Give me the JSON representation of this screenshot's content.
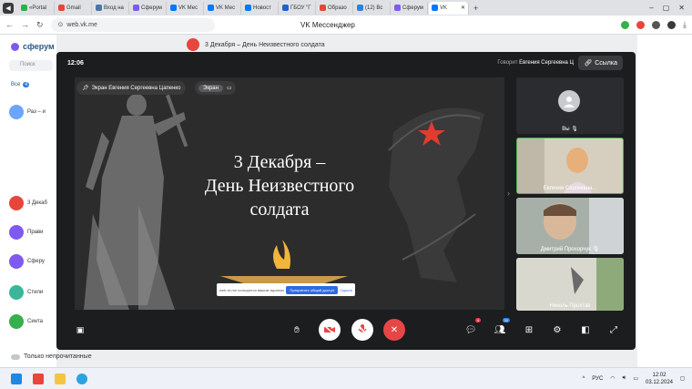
{
  "browser": {
    "tabs": [
      {
        "label": "«Portal",
        "color": "#29b34a"
      },
      {
        "label": "Gmail",
        "color": "#ea4335"
      },
      {
        "label": "Вход на",
        "color": "#4a76a8"
      },
      {
        "label": "Сферум",
        "color": "#7f5af0"
      },
      {
        "label": "VK Мес",
        "color": "#0077ff"
      },
      {
        "label": "VK Мес",
        "color": "#0077ff"
      },
      {
        "label": "Новост",
        "color": "#0077ff"
      },
      {
        "label": "ГБОУ \"Г",
        "color": "#1e63c8"
      },
      {
        "label": "Образо",
        "color": "#e8453c"
      },
      {
        "label": "(12) Вс",
        "color": "#2d81e0"
      },
      {
        "label": "Сферум",
        "color": "#7f5af0"
      }
    ],
    "active_tab": {
      "label": "VK",
      "color": "#0077ff"
    },
    "url": "web.vk.me",
    "page_title": "VK Мессенджер"
  },
  "app": {
    "logo": "сферум",
    "search_placeholder": "Поиск",
    "tabs_all": "Все",
    "tabs_all_count": "4",
    "chat_header_title": "3 Декабря – День Неизвестного солдата",
    "left_chats": [
      {
        "name": "Раз – и",
        "color": "#6aa6ff"
      },
      {
        "name": "3 Декаб",
        "color": "#e8453c"
      },
      {
        "name": "Прави",
        "color": "#7f5af0"
      },
      {
        "name": "Сферу",
        "color": "#7f5af0"
      },
      {
        "name": "Стили",
        "color": "#3ab79a"
      },
      {
        "name": "Синта",
        "color": "#35b04a"
      }
    ],
    "only_unread_label": "Только непрочитанные"
  },
  "call": {
    "time": "12:06",
    "speaker_prefix": "Говорит",
    "speaker_name": "Евгения Сергеевна Ц",
    "link_label": "Ссылка",
    "screen_owner_label": "Экран Евгения Сергеевна Цапенко",
    "screen_tab_label": "Экран",
    "slide_title_line1": "3 Декабря –",
    "slide_title_line2": "День Неизвестного",
    "slide_title_line3": "солдата",
    "share_notice": "web.vk.me пользуется вашим экраном",
    "share_stop_label": "Прекратить общий доступ",
    "share_hide_label": "Скрыть",
    "participants": [
      {
        "name": "Вы"
      },
      {
        "name": "Евгения Сергеевна..."
      },
      {
        "name": "Дмитрий Прохорчук"
      },
      {
        "name": "Николь Прохтав"
      }
    ],
    "chat_badge": "4",
    "participants_badge": "30"
  },
  "taskbar": {
    "lang": "РУС",
    "time": "12:02",
    "date": "03.12.2024"
  }
}
